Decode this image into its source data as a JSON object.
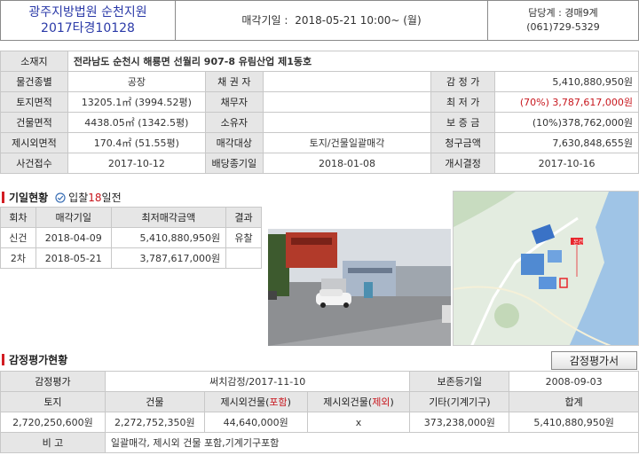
{
  "header": {
    "court": "광주지방법원 순천지원",
    "case_no": "2017타경10128",
    "sale_date_label": "매각기일 :",
    "sale_date": "2018-05-21 10:00~ (월)",
    "dept": "담당계 : 경매9계",
    "phone": "(061)729-5329"
  },
  "info": {
    "address_label": "소재지",
    "address": "전라남도 순천시 해룡면 선월리 907-8 유림산업 제1동호",
    "type_label": "물건종별",
    "type": "공장",
    "creditor_label": "채 권 자",
    "creditor": "",
    "appraisal_label": "감 정 가",
    "appraisal": "5,410,880,950원",
    "land_label": "토지면적",
    "land": "13205.1㎡ (3994.52평)",
    "debtor_label": "채무자",
    "debtor": "",
    "min_label": "최 저 가",
    "min": "(70%) 3,787,617,000원",
    "bldg_label": "건물면적",
    "bldg": "4438.05㎡ (1342.5평)",
    "owner_label": "소유자",
    "owner": "",
    "deposit_label": "보 증 금",
    "deposit": "(10%)378,762,000원",
    "excl_label": "제시외면적",
    "excl": "170.4㎡ (51.55평)",
    "target_label": "매각대상",
    "target": "토지/건물일괄매각",
    "claim_label": "청구금액",
    "claim": "7,630,848,655원",
    "received_label": "사건접수",
    "received": "2017-10-12",
    "deadline_label": "배당종기일",
    "deadline": "2018-01-08",
    "decision_label": "개시결정",
    "decision": "2017-10-16"
  },
  "history": {
    "title": "기일현황",
    "bid_prefix": "입찰",
    "bid_days": "18",
    "bid_suffix": "일전",
    "headers": [
      "회차",
      "매각기일",
      "최저매각금액",
      "결과"
    ],
    "rows": [
      [
        "신건",
        "2018-04-09",
        "5,410,880,950원",
        "유찰"
      ],
      [
        "2차",
        "2018-05-21",
        "3,787,617,000원",
        ""
      ]
    ]
  },
  "map": {
    "marker": "본건"
  },
  "appraisal": {
    "title": "감정평가현황",
    "button": "감정평가서",
    "r1": [
      "감정평가",
      "써치감정/2017-11-10",
      "보존등기일",
      "2008-09-03"
    ],
    "h2": [
      "토지",
      "건물",
      "제시외건물(",
      "포함",
      ")",
      "제시외건물(",
      "제외",
      ")",
      "기타(기계기구)",
      "합계"
    ],
    "r3": [
      "2,720,250,600원",
      "2,272,752,350원",
      "44,640,000원",
      "x",
      "373,238,000원",
      "5,410,880,950원"
    ],
    "note_label": "비 고",
    "note": "일괄매각, 제시외 건물 포함,기계기구포함"
  },
  "colors": {
    "court": "#2b3aa8",
    "accent": "#c8171e",
    "label_bg": "#e6e6e6"
  }
}
